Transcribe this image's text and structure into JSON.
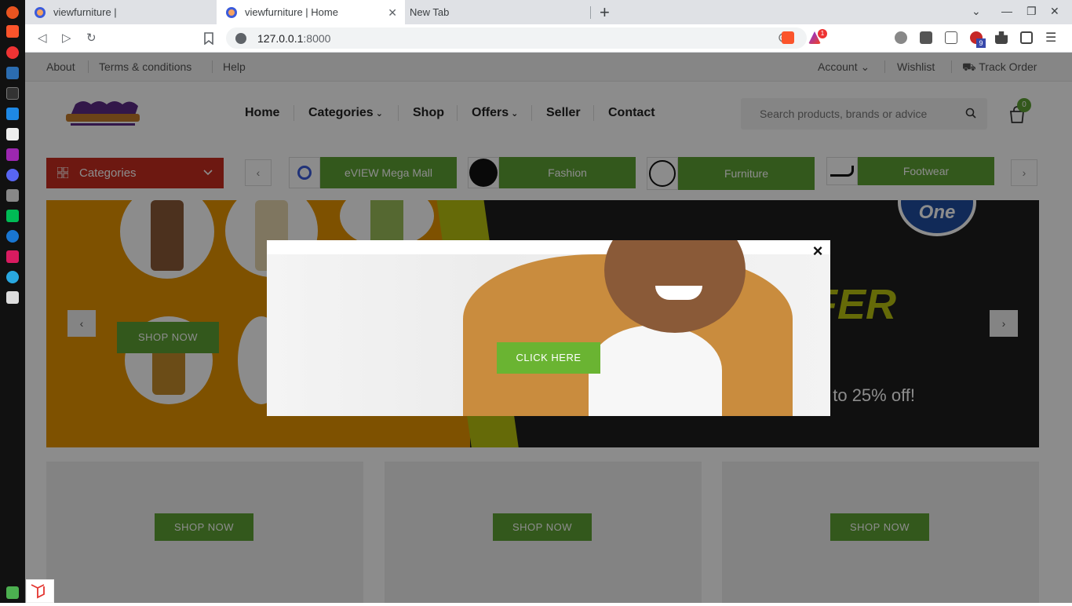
{
  "browser": {
    "tabs": [
      {
        "title": "viewfurniture |",
        "active": false
      },
      {
        "title": "viewfurniture | Home",
        "active": true
      },
      {
        "title": "New Tab",
        "active": false
      }
    ],
    "new_tab_symbol": "+",
    "close_tab_symbol": "✕",
    "url_host": "127.0.0.1",
    "url_port": ":8000",
    "nav_back": "◁",
    "nav_forward": "▷",
    "nav_reload": "↻",
    "brave_notif_count": "1",
    "ext_badge_count": "9",
    "win_controls": {
      "dropdown": "⌄",
      "minimize": "—",
      "maximize": "❐",
      "close": "✕"
    }
  },
  "topbar": {
    "links": [
      "About",
      "Terms & conditions",
      "Help"
    ],
    "account": "Account",
    "wishlist": "Wishlist",
    "track_order": "Track Order"
  },
  "header": {
    "menu": [
      "Home",
      "Categories",
      "Shop",
      "Offers",
      "Seller",
      "Contact"
    ],
    "search_placeholder": "Search products, brands or advice",
    "cart_count": "0"
  },
  "categories_button": "Categories",
  "shop_categories": [
    {
      "label": "eVIEW Mega Mall",
      "icon": "eview-logo-icon"
    },
    {
      "label": "Fashion",
      "icon": "fashion-icon"
    },
    {
      "label": "Furniture",
      "icon": "sofa-icon"
    },
    {
      "label": "Footwear",
      "icon": "shoe-icon"
    }
  ],
  "hero": {
    "shop_now": "SHOP NOW",
    "headline_partial": "FER",
    "headline_char": "E",
    "subtext_partial": "Up to 25% off!",
    "badge_partial": "One",
    "prev": "‹",
    "next": "›"
  },
  "banners": [
    {
      "button": "SHOP NOW"
    },
    {
      "button": "SHOP NOW"
    },
    {
      "button": "SHOP NOW"
    }
  ],
  "modal": {
    "close": "×",
    "cta": "CLICK HERE"
  },
  "colors": {
    "accent_green": "#5da134",
    "category_red": "#c62d20",
    "hero_orange": "#e69400",
    "hero_dark": "#1e1e1e",
    "hero_lime": "#b9c10f"
  }
}
